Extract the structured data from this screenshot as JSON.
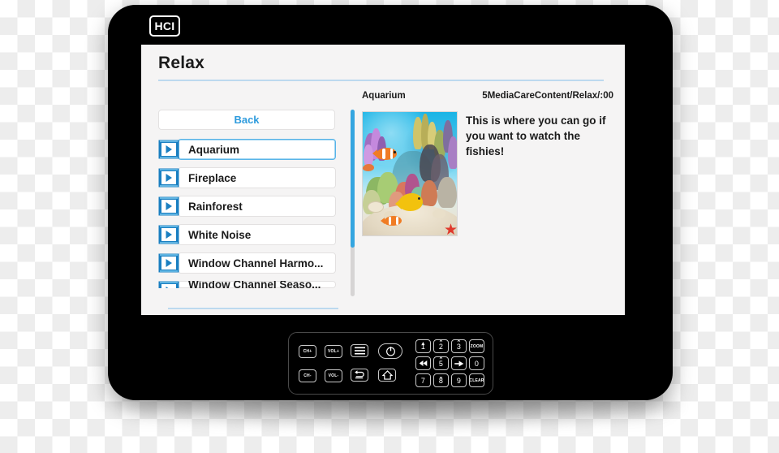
{
  "device": {
    "logo_text": "HCI"
  },
  "screen": {
    "page_title": "Relax",
    "back_label": "Back",
    "media_items": [
      {
        "label": "Aquarium",
        "icon": "video-play-icon",
        "selected": true
      },
      {
        "label": "Fireplace",
        "icon": "video-play-icon",
        "selected": false
      },
      {
        "label": "Rainforest",
        "icon": "video-play-icon",
        "selected": false
      },
      {
        "label": "White Noise",
        "icon": "video-play-icon",
        "selected": false
      },
      {
        "label": "Window Channel Harmo...",
        "icon": "video-play-icon",
        "selected": false
      },
      {
        "label": "Window Channel Seaso...",
        "icon": "video-play-icon",
        "selected": false
      }
    ],
    "detail": {
      "title": "Aquarium",
      "path": "5MediaCareContent/Relax/:00",
      "description": "This is where you can go if you want to watch the fishies!",
      "thumbnail_alt": "aquarium-coral-reef-thumbnail"
    }
  },
  "remote": {
    "function_keys": [
      {
        "label": "CH+",
        "name": "channel-up-key"
      },
      {
        "label": "VOL+",
        "name": "volume-up-key"
      },
      {
        "label": "",
        "name": "menu-key"
      },
      {
        "label": "",
        "name": "power-key"
      },
      {
        "label": "CH-",
        "name": "channel-down-key"
      },
      {
        "label": "VOL-",
        "name": "volume-down-key"
      },
      {
        "label": "",
        "name": "back-key"
      },
      {
        "label": "",
        "name": "home-key"
      }
    ],
    "keypad_keys": [
      {
        "label": "1",
        "name": "key-1",
        "overlay": ""
      },
      {
        "label": "2",
        "name": "key-2",
        "overlay": ""
      },
      {
        "label": "3",
        "name": "key-3",
        "overlay": ""
      },
      {
        "label": "ZOOM",
        "name": "zoom-key",
        "overlay": ""
      },
      {
        "label": "",
        "name": "rewind-key",
        "overlay": ""
      },
      {
        "label": "5",
        "name": "key-5",
        "overlay": ""
      },
      {
        "label": "",
        "name": "play-key",
        "overlay": ""
      },
      {
        "label": "0",
        "name": "key-0",
        "overlay": ""
      },
      {
        "label": "7",
        "name": "key-7",
        "overlay": ""
      },
      {
        "label": "8",
        "name": "key-8",
        "overlay": ""
      },
      {
        "label": "9",
        "name": "key-9",
        "overlay": ""
      },
      {
        "label": "CLEAR",
        "name": "clear-key",
        "overlay": ""
      }
    ]
  },
  "colors": {
    "accent": "#2e9bdd",
    "scroll_thumb": "#35a6e0",
    "rule": "#bcd9ef",
    "screen_bg": "#f5f4f4",
    "bezel": "#000000"
  }
}
